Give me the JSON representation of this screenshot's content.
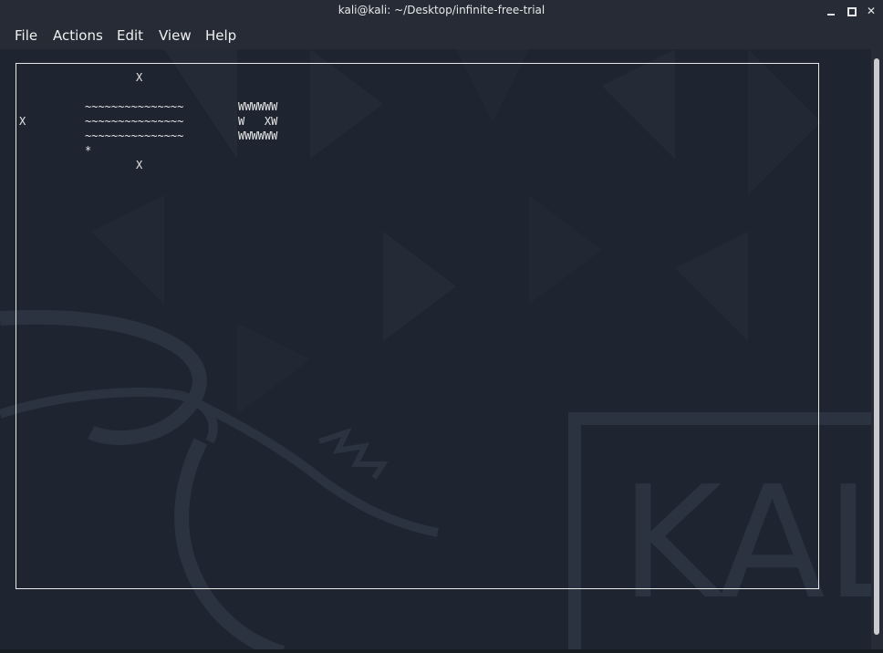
{
  "window": {
    "title": "kali@kali: ~/Desktop/infinite-free-trial",
    "controls": {
      "minimize": "minimize-icon",
      "maximize": "maximize-icon",
      "close": "close-icon",
      "close_glyph": "✕"
    }
  },
  "menu": {
    "items": [
      "File",
      "Actions",
      "Edit",
      "View",
      "Help"
    ]
  },
  "terminal": {
    "lines": {
      "x_top": "X",
      "water_1": "~~~~~~~~~~~~~~~",
      "water_2": "~~~~~~~~~~~~~~~",
      "water_3": "~~~~~~~~~~~~~~~",
      "wall_1": "WWWWWW",
      "wall_2": "W   XW",
      "wall_3": "WWWWWW",
      "x_left": "X",
      "player": "*",
      "x_bottom": "X"
    },
    "background_watermark": "KAL",
    "colors": {
      "text": "#e8e8e8",
      "background": "#1e2430"
    }
  }
}
